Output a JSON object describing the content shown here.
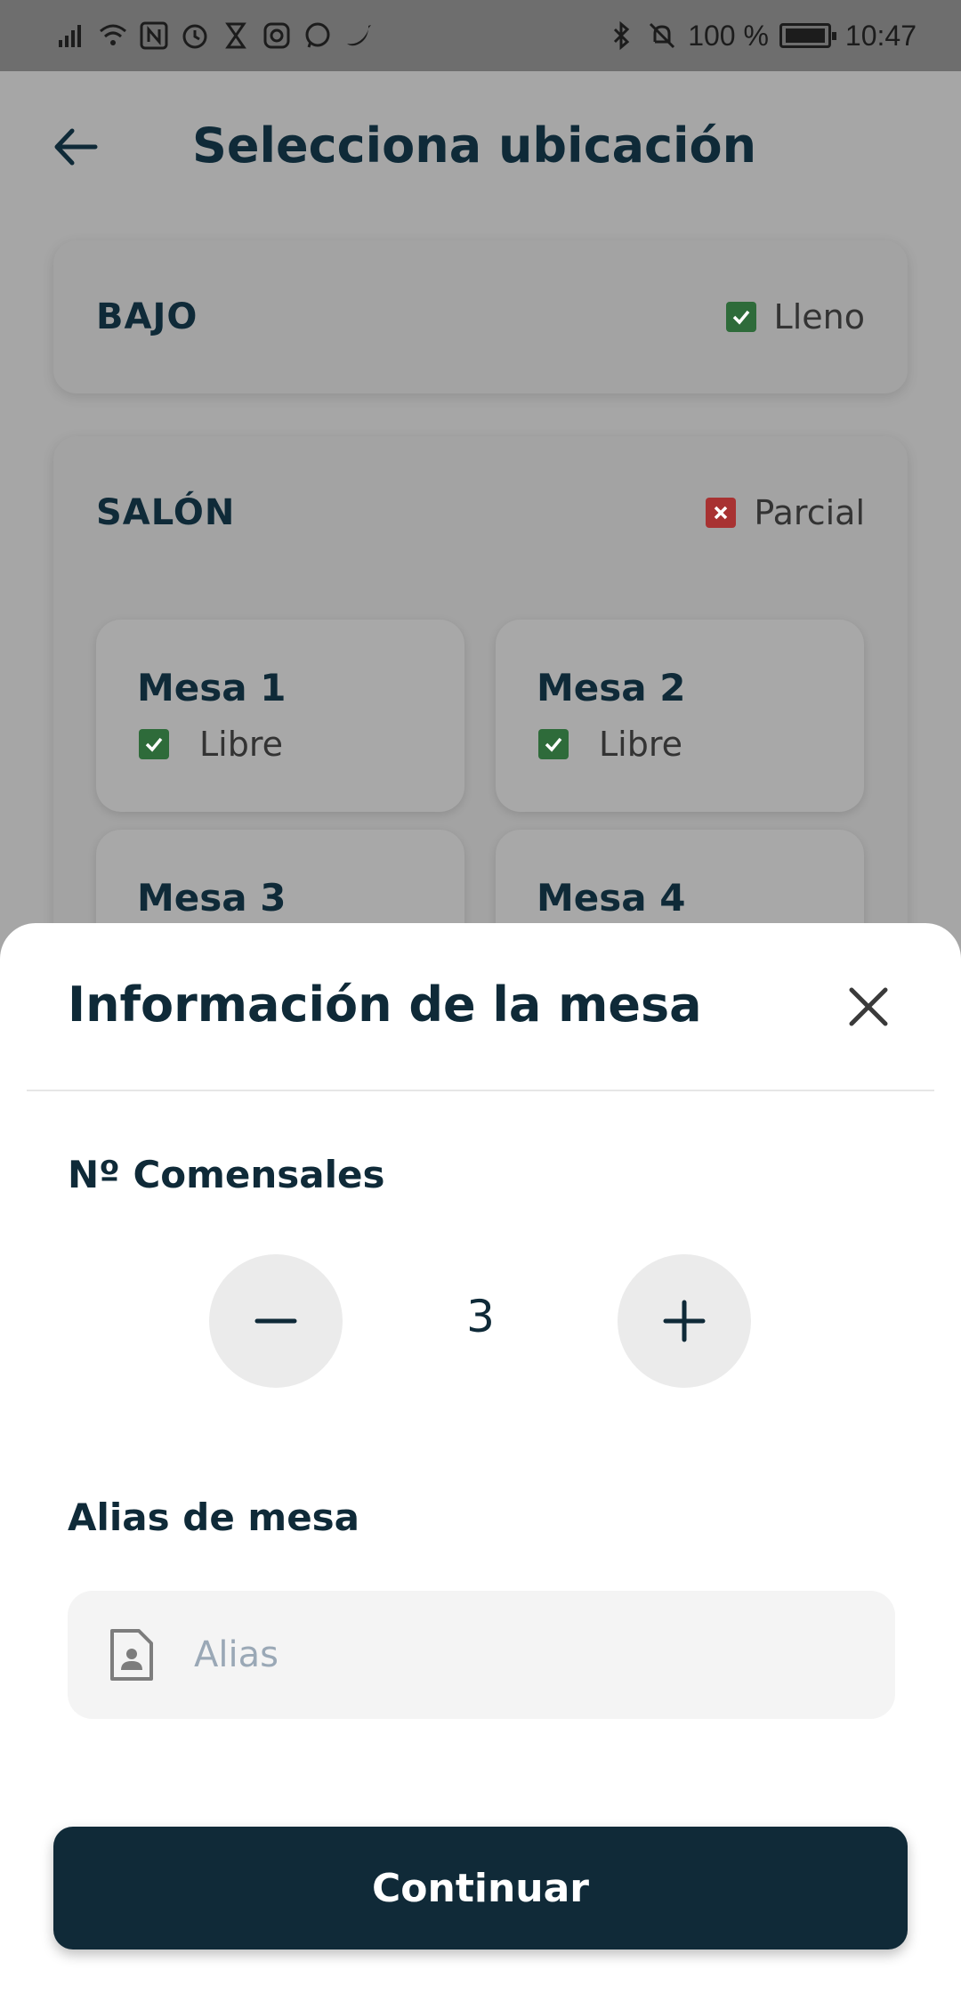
{
  "status_bar": {
    "left_icons": [
      "signal-icon",
      "wifi-icon",
      "nfc-icon",
      "alarm-icon",
      "hourglass-icon",
      "instagram-icon",
      "whatsapp-icon",
      "twitter-icon"
    ],
    "right_icons": [
      "bluetooth-icon",
      "mute-icon"
    ],
    "battery_text": "100 %",
    "time": "10:47"
  },
  "header": {
    "title": "Selecciona ubicación"
  },
  "zones": [
    {
      "name": "BAJO",
      "status": "Lleno",
      "status_color": "#2e6b3a"
    },
    {
      "name": "SALÓN",
      "status": "Parcial",
      "status_color": "#a83232"
    }
  ],
  "tables": [
    {
      "name": "Mesa 1",
      "status": "Libre"
    },
    {
      "name": "Mesa 2",
      "status": "Libre"
    },
    {
      "name": "Mesa 3"
    },
    {
      "name": "Mesa 4"
    }
  ],
  "sheet": {
    "title": "Información de la mesa",
    "diners_label": "Nº Comensales",
    "diners_value": "3",
    "alias_label": "Alias de mesa",
    "alias_placeholder": "Alias",
    "alias_value": "",
    "continue_label": "Continuar"
  },
  "colors": {
    "primary": "#102a38",
    "overlay": "#a6a6a6",
    "free_green": "#2e6b3a",
    "partial_red": "#a83232"
  }
}
